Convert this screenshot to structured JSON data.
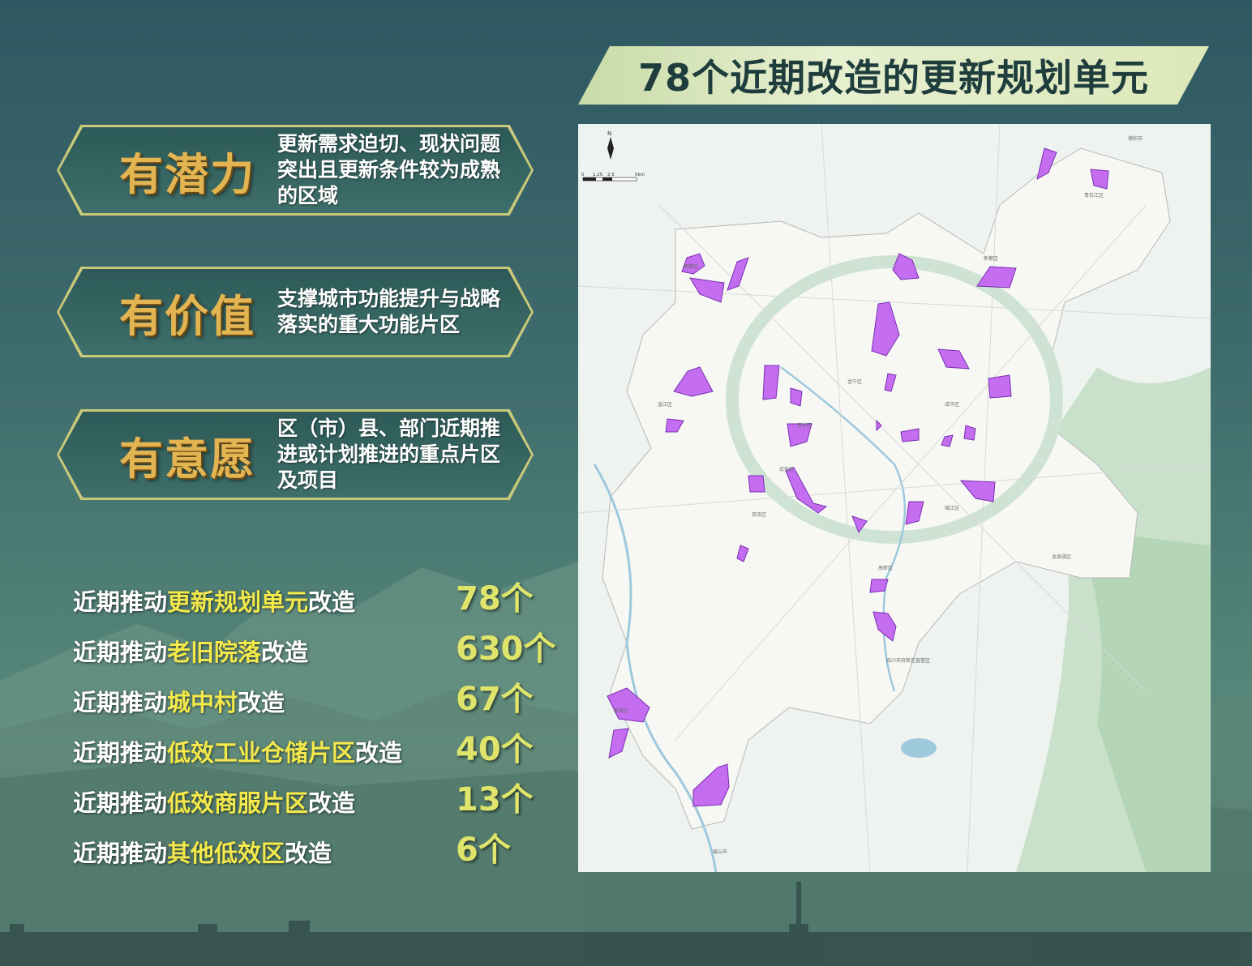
{
  "title": "78个近期改造的更新规划单元",
  "features": [
    {
      "heading": "有潜力",
      "lines": [
        "更新需求迫切、现状问题",
        "突出且更新条件较为成熟",
        "的区域"
      ]
    },
    {
      "heading": "有价值",
      "lines": [
        "支撑城市功能提升与战略",
        "落实的重大功能片区"
      ]
    },
    {
      "heading": "有意愿",
      "lines": [
        "区（市）县、部门近期推",
        "进或计划推进的重点片区",
        "及项目"
      ]
    }
  ],
  "stats": [
    {
      "prefix": "近期推动",
      "highlight": "更新规划单元",
      "suffix": "改造",
      "count": "78个"
    },
    {
      "prefix": "近期推动",
      "highlight": "老旧院落",
      "suffix": "改造",
      "count": "630个"
    },
    {
      "prefix": "近期推动",
      "highlight": "城中村",
      "suffix": "改造",
      "count": "67个"
    },
    {
      "prefix": "近期推动",
      "highlight": "低效工业仓储片区",
      "suffix": "改造",
      "count": "40个"
    },
    {
      "prefix": "近期推动",
      "highlight": "低效商服片区",
      "suffix": "改造",
      "count": "13个"
    },
    {
      "prefix": "近期推动",
      "highlight": "其他低效区",
      "suffix": "改造",
      "count": "6个"
    }
  ],
  "map": {
    "north_label": "N",
    "scale_labels": [
      "0",
      "1.25",
      "2.5",
      "5km"
    ],
    "places": [
      "郫都区",
      "新都区",
      "青白江区",
      "温江区",
      "金牛区",
      "成华区",
      "青羊区",
      "武侯区",
      "锦江区",
      "双流区",
      "高新区",
      "龙泉驿区",
      "新津区",
      "四川天府新区直管区",
      "眉山市",
      "德阳市"
    ],
    "colors": {
      "unit_fill": "#c46df0",
      "unit_stroke": "#7a2fb0",
      "land": "#f7f8f4",
      "water": "#9ec8dc",
      "ring": "#cfe3d4",
      "hills": "#b9d9bb"
    }
  }
}
